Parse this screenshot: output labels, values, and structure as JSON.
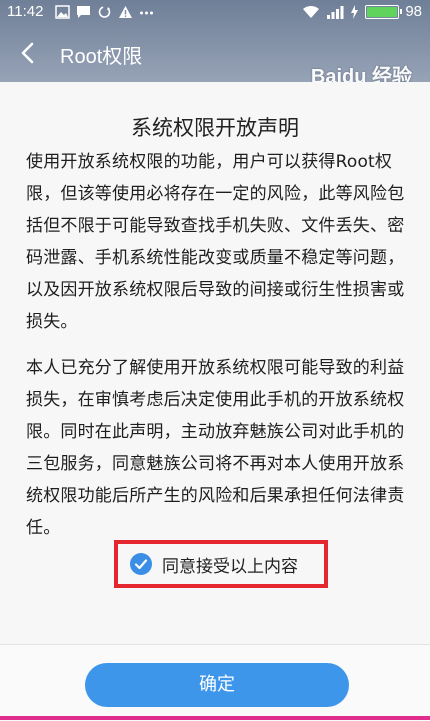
{
  "status_bar": {
    "time": "11:42",
    "battery_level": "98",
    "battery_percent": 98
  },
  "toolbar": {
    "title": "Root权限"
  },
  "declaration": {
    "title": "系统权限开放声明",
    "paragraph1": "使用开放系统权限的功能，用户可以获得Root权限，但该等使用必将存在一定的风险，此等风险包括但不限于可能导致查找手机失败、文件丢失、密码泄露、手机系统性能改变或质量不稳定等问题，以及因开放系统权限后导致的间接或衍生性损害或损失。",
    "paragraph2": "本人已充分了解使用开放系统权限可能导致的利益损失，在审慎考虑后决定使用此手机的开放系统权限。同时在此声明，主动放弃魅族公司对此手机的三包服务，同意魅族公司将不再对本人使用开放系统权限功能后所产生的风险和后果承担任何法律责任。"
  },
  "agreement": {
    "label": "同意接受以上内容",
    "checked": true
  },
  "footer": {
    "confirm_label": "确定"
  },
  "watermark": "Baidu 经验",
  "colors": {
    "accent": "#3d96ea",
    "highlight_border": "#e4262f",
    "battery": "#5fd35b"
  }
}
